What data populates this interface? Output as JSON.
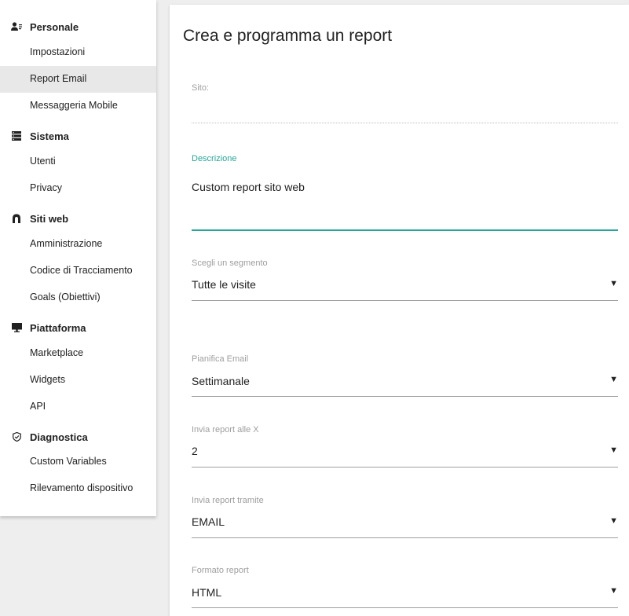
{
  "sidebar": {
    "sections": [
      {
        "title": "Personale",
        "icon": "user-settings-icon",
        "items": [
          "Impostazioni",
          "Report Email",
          "Messaggeria Mobile"
        ]
      },
      {
        "title": "Sistema",
        "icon": "server-icon",
        "items": [
          "Utenti",
          "Privacy"
        ]
      },
      {
        "title": "Siti web",
        "icon": "website-icon",
        "items": [
          "Amministrazione",
          "Codice di Tracciamento",
          "Goals (Obiettivi)"
        ]
      },
      {
        "title": "Piattaforma",
        "icon": "monitor-icon",
        "items": [
          "Marketplace",
          "Widgets",
          "API"
        ]
      },
      {
        "title": "Diagnostica",
        "icon": "shield-check-icon",
        "items": [
          "Custom Variables",
          "Rilevamento dispositivo"
        ]
      }
    ],
    "active_item": "Report Email"
  },
  "main": {
    "title": "Crea e programma un report",
    "site": {
      "label": "Sito:",
      "value": ""
    },
    "description": {
      "label": "Descrizione",
      "value": "Custom report sito web"
    },
    "segment": {
      "label": "Scegli un segmento",
      "value": "Tutte le visite"
    },
    "schedule": {
      "label": "Pianifica Email",
      "value": "Settimanale"
    },
    "send_hour": {
      "label": "Invia report alle X",
      "value": "2"
    },
    "send_via": {
      "label": "Invia report tramite",
      "value": "EMAIL"
    },
    "format": {
      "label": "Formato report",
      "value": "HTML"
    }
  },
  "colors": {
    "accent": "#26a69a",
    "active_bg": "#e8e8e8"
  }
}
